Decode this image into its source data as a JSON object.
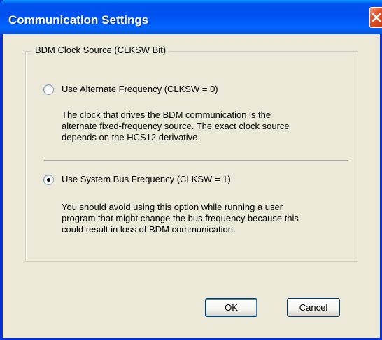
{
  "window": {
    "title": "Communication Settings"
  },
  "group": {
    "title": "BDM Clock Source (CLKSW Bit)"
  },
  "options": [
    {
      "label": "Use Alternate Frequency (CLKSW = 0)",
      "selected": false,
      "description": [
        "The clock that drives the BDM communication is the",
        "alternate fixed-frequency source. The exact clock source",
        "depends on the HCS12 derivative."
      ]
    },
    {
      "label": "Use System Bus Frequency (CLKSW = 1)",
      "selected": true,
      "description": [
        "You should avoid using this option while running a user",
        "program that might change the bus frequency because this",
        "could result in loss of BDM communication."
      ]
    }
  ],
  "buttons": {
    "ok": "OK",
    "cancel": "Cancel"
  },
  "icons": {
    "close": "close-icon"
  },
  "colors": {
    "titlebar": "#0053ee",
    "dialog_bg": "#ece9d8",
    "close_button": "#e0542e"
  }
}
